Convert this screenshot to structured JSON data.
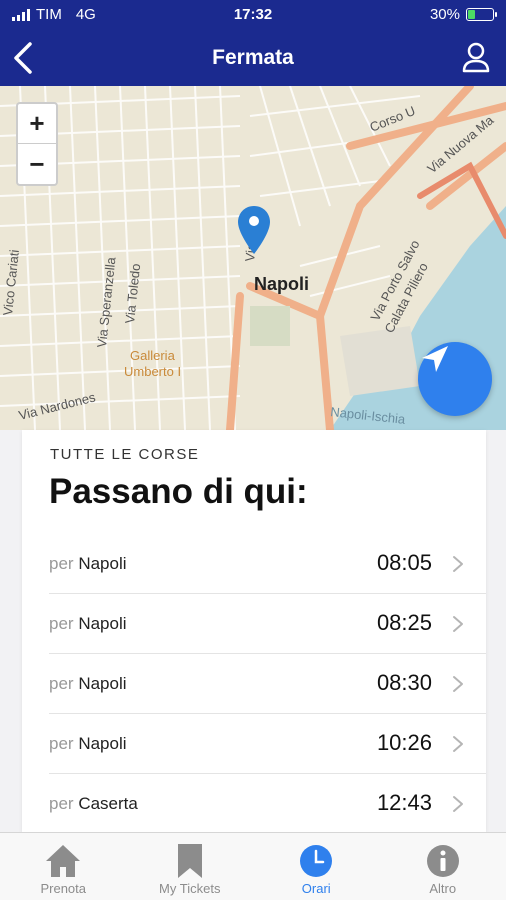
{
  "status_bar": {
    "carrier": "TIM",
    "network": "4G",
    "time": "17:32",
    "battery": "30%",
    "battery_level": 0.3
  },
  "header": {
    "title": "Fermata"
  },
  "map": {
    "zoom_in": "+",
    "zoom_out": "−",
    "place_label": "Napoli",
    "street_labels": [
      "Vico Cariati",
      "Via Speranzella",
      "Via Toledo",
      "Galleria",
      "Umberto I",
      "Via Nardones",
      "Via Porto Salvo",
      "Calata Piliero",
      "Via Nuova Ma",
      "Corso U",
      "Napoli-Ischia",
      "Via"
    ]
  },
  "departures": {
    "section_label": "TUTTE LE CORSE",
    "title": "Passano di qui:",
    "per_label": "per",
    "rows": [
      {
        "destination": "Napoli",
        "time": "08:05"
      },
      {
        "destination": "Napoli",
        "time": "08:25"
      },
      {
        "destination": "Napoli",
        "time": "08:30"
      },
      {
        "destination": "Napoli",
        "time": "10:26"
      },
      {
        "destination": "Caserta",
        "time": "12:43"
      }
    ]
  },
  "tabbar": {
    "tabs": [
      {
        "label": "Prenota",
        "icon": "home-icon"
      },
      {
        "label": "My Tickets",
        "icon": "bookmark-icon"
      },
      {
        "label": "Orari",
        "icon": "clock-icon",
        "active": true
      },
      {
        "label": "Altro",
        "icon": "info-icon"
      }
    ]
  },
  "colors": {
    "header_bg": "#1b2a8f",
    "accent": "#2f80ed",
    "battery_fill": "#4cd964",
    "tab_inactive": "#8c8c8c"
  }
}
